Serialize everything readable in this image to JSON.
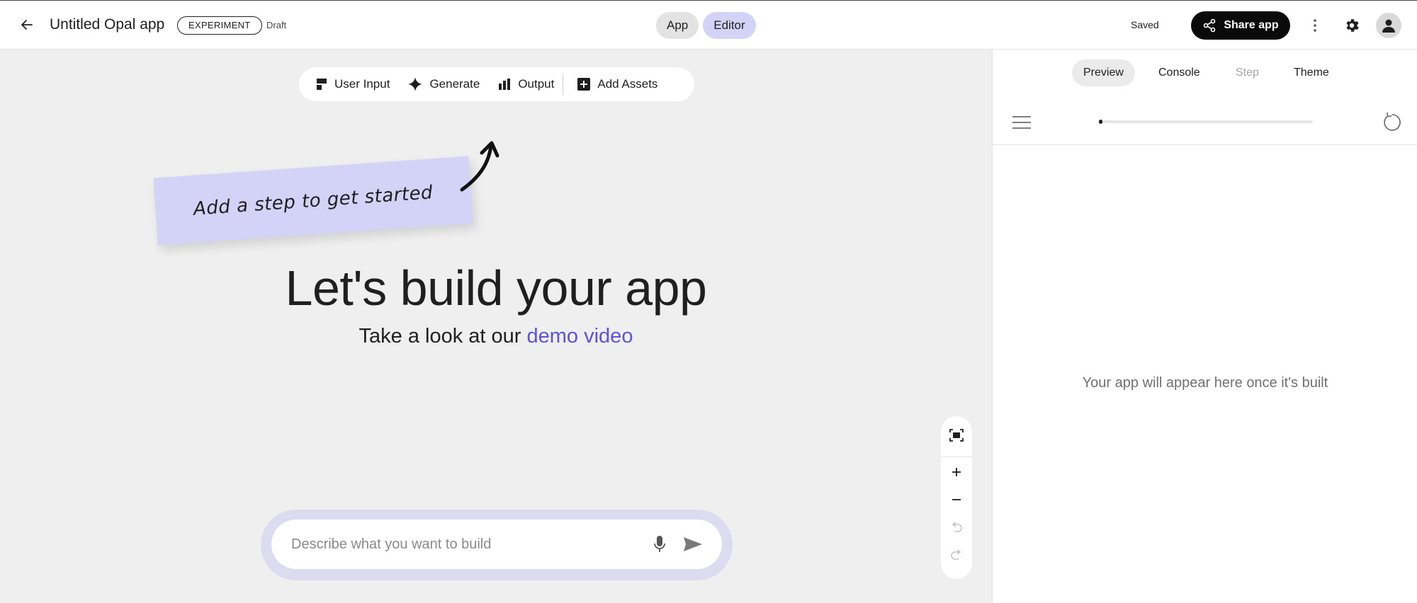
{
  "header": {
    "app_title": "Untitled Opal app",
    "badge": "EXPERIMENT",
    "status": "Draft",
    "modes": {
      "app": "App",
      "editor": "Editor",
      "active": "Editor"
    },
    "saved": "Saved",
    "share_label": "Share app"
  },
  "toolbar": {
    "items": [
      {
        "label": "User Input",
        "icon": "user-input-icon"
      },
      {
        "label": "Generate",
        "icon": "sparkle-icon"
      },
      {
        "label": "Output",
        "icon": "output-icon"
      }
    ],
    "assets_label": "Add Assets"
  },
  "canvas": {
    "sticky_note": "Add a step to get started",
    "headline": "Let's build your app",
    "subline_prefix": "Take a look at our ",
    "subline_link": "demo video"
  },
  "prompt": {
    "placeholder": "Describe what you want to build",
    "value": ""
  },
  "panel": {
    "tabs": [
      "Preview",
      "Console",
      "Step",
      "Theme"
    ],
    "active_tab": "Preview",
    "disabled_tab": "Step",
    "progress": 0.01,
    "empty_message": "Your app will appear here once it's built"
  },
  "colors": {
    "accent": "#d3d2f7",
    "link": "#5b53e0",
    "canvas_bg": "#efefef",
    "prompt_ring": "#dcdbf0",
    "share_bg": "#0a0a0a"
  }
}
